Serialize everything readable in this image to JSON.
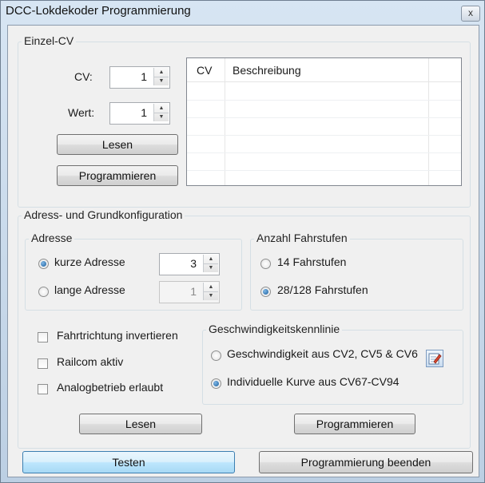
{
  "window": {
    "title": "DCC-Lokdekoder Programmierung",
    "close_glyph": "x"
  },
  "einzel_cv": {
    "group_label": "Einzel-CV",
    "cv_label": "CV:",
    "cv_value": "1",
    "wert_label": "Wert:",
    "wert_value": "1",
    "read_button": "Lesen",
    "program_button": "Programmieren",
    "table": {
      "columns": [
        "CV",
        "Beschreibung"
      ],
      "rows": []
    }
  },
  "grundkonfiguration": {
    "group_label": "Adress- und Grundkonfiguration",
    "adresse": {
      "group_label": "Adresse",
      "short_label": "kurze Adresse",
      "short_value": "3",
      "short_selected": true,
      "long_label": "lange Adresse",
      "long_value": "1",
      "long_selected": false
    },
    "fahrstufen": {
      "group_label": "Anzahl Fahrstufen",
      "option_14": "14 Fahrstufen",
      "option_28": "28/128 Fahrstufen",
      "selected": "28/128"
    },
    "options": [
      {
        "label": "Fahrtrichtung invertieren",
        "checked": false
      },
      {
        "label": "Railcom aktiv",
        "checked": false
      },
      {
        "label": "Analogbetrieb erlaubt",
        "checked": false
      }
    ],
    "kennlinie": {
      "group_label": "Geschwindigkeitskennlinie",
      "option_cv": "Geschwindigkeit aus CV2, CV5 & CV6",
      "option_curve": "Individuelle Kurve aus CV67-CV94",
      "selected": "curve",
      "edit_icon": "edit-curve-icon"
    },
    "read_button": "Lesen",
    "program_button": "Programmieren"
  },
  "footer": {
    "test_button": "Testen",
    "finish_button": "Programmierung beenden"
  },
  "colors": {
    "accent": "#1b5f9d",
    "focus_border": "#3c7fb1",
    "group_border": "#d5dfe5"
  }
}
